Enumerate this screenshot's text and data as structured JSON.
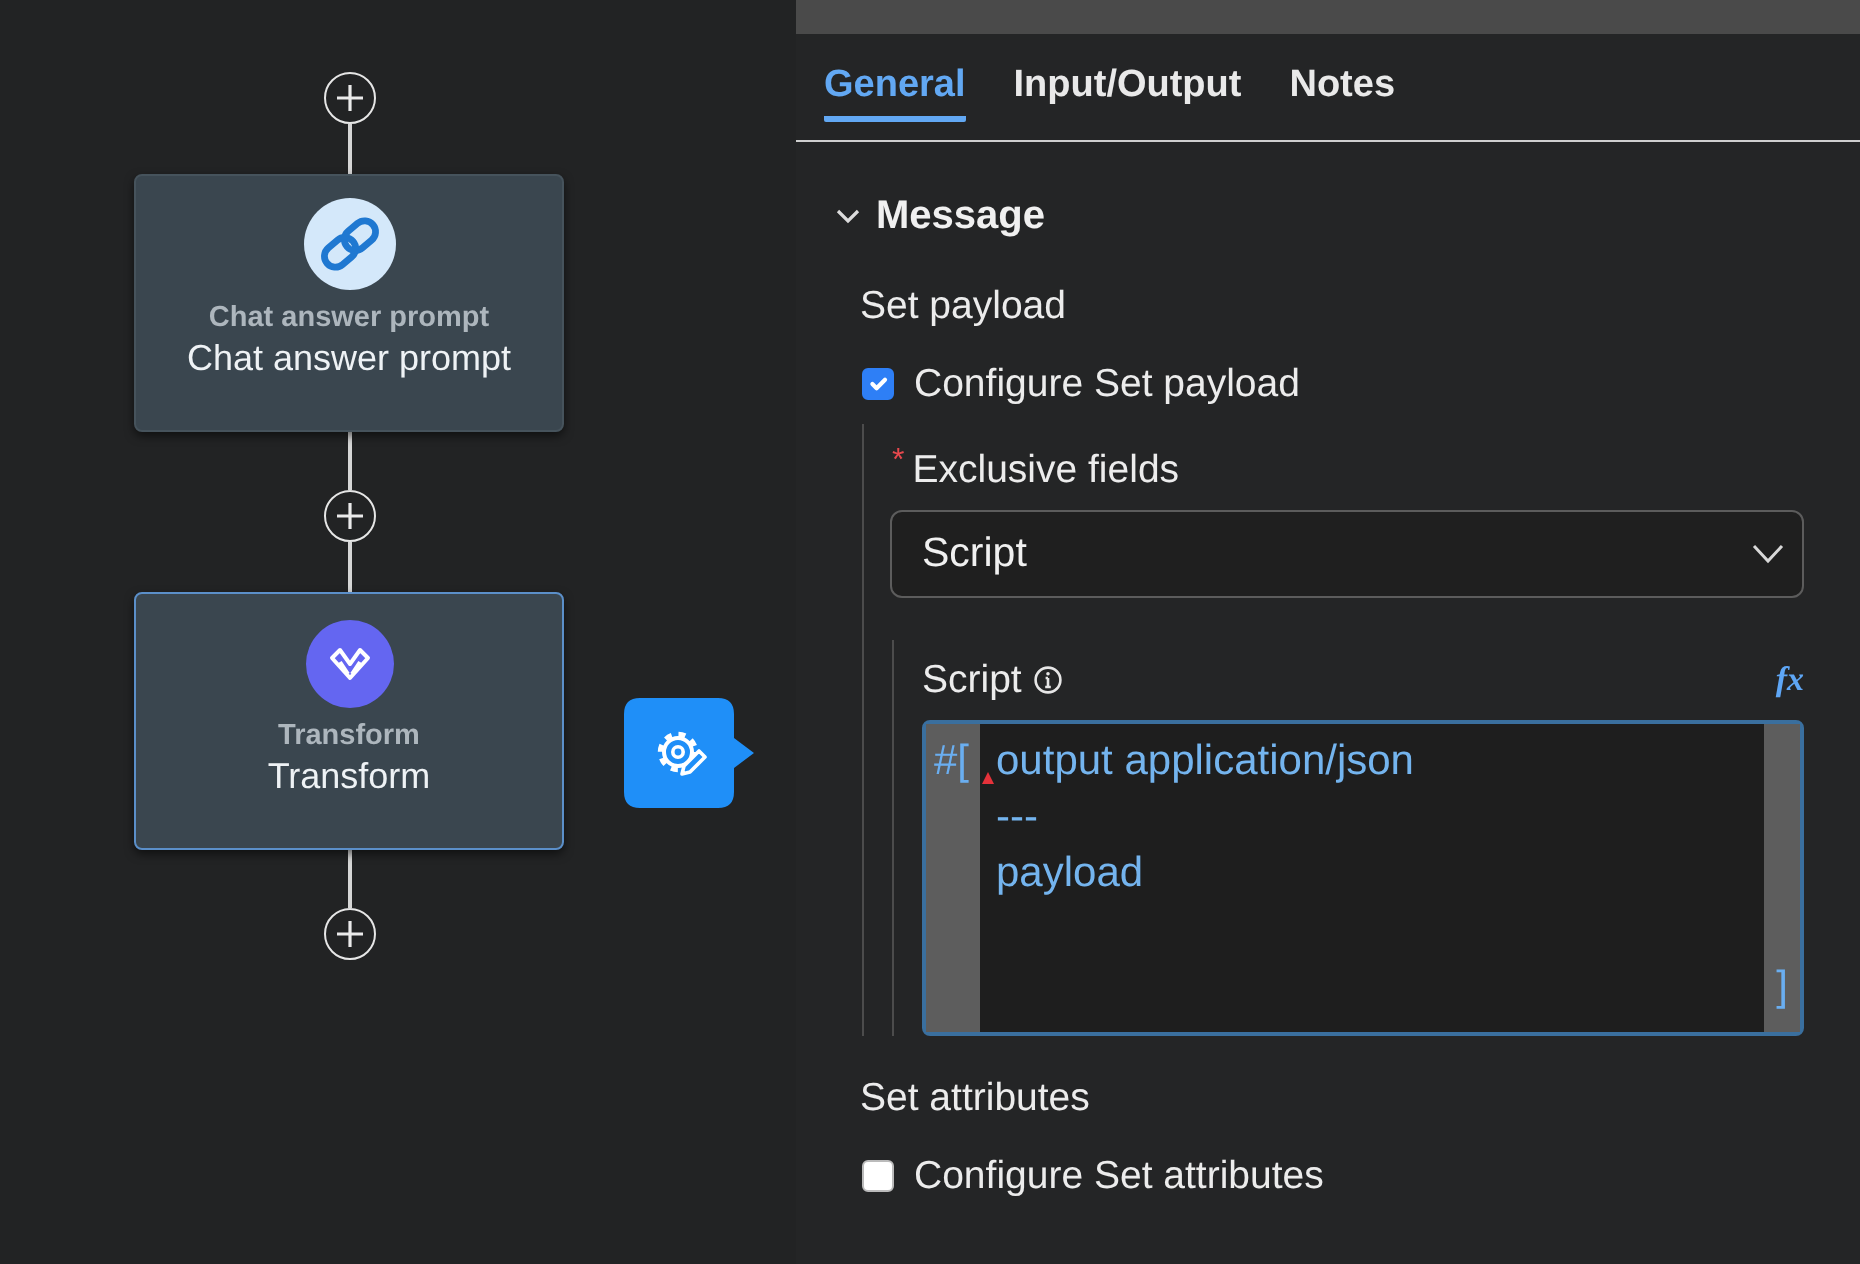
{
  "canvas": {
    "nodes": [
      {
        "kind": "prompt",
        "caption": "Chat answer prompt",
        "title": "Chat answer prompt",
        "selected": false
      },
      {
        "kind": "transform",
        "caption": "Transform",
        "title": "Transform",
        "selected": true
      }
    ]
  },
  "panel": {
    "tabs": [
      {
        "label": "General",
        "selected": true
      },
      {
        "label": "Input/Output",
        "selected": false
      },
      {
        "label": "Notes",
        "selected": false
      }
    ],
    "section": {
      "title": "Message",
      "expanded": true,
      "groups": [
        {
          "label": "Set payload",
          "option": {
            "label": "Configure Set payload",
            "checked": true
          },
          "exclusive_fields": {
            "required_mark": "*",
            "label": "Exclusive fields",
            "value": "Script"
          },
          "script": {
            "label": "Script",
            "expression_button": "fx",
            "open_delimiter": "#[",
            "close_delimiter": "]",
            "lines": [
              {
                "text": "output application/json",
                "error": true
              },
              {
                "text": "---",
                "error": false
              },
              {
                "text": "payload",
                "error": false
              }
            ]
          }
        },
        {
          "label": "Set attributes",
          "option": {
            "label": "Configure Set attributes",
            "checked": false
          }
        }
      ]
    }
  }
}
